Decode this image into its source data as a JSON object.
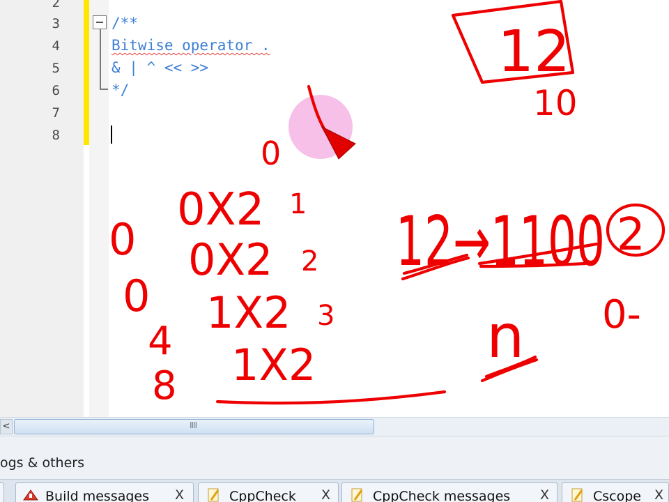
{
  "editor": {
    "line_numbers": [
      "2",
      "3",
      "4",
      "5",
      "6",
      "7",
      "8"
    ],
    "code_lines": [
      "/**",
      "Bitwise operator .",
      "& | ^ << >>",
      "*/"
    ]
  },
  "annotations": {
    "box_number": "12",
    "below_box": "10",
    "binary_expr": "12→1100",
    "circled": "2",
    "partial": "0-",
    "n_label": "n",
    "zero_top": "0",
    "left_digits": [
      "0",
      "0",
      "4",
      "8"
    ],
    "powers": [
      {
        "term": "0X2",
        "exp": "1"
      },
      {
        "term": "0X2",
        "exp": "2"
      },
      {
        "term": "1X2",
        "exp": "3"
      },
      {
        "term": "1X2",
        "exp": ""
      }
    ]
  },
  "scrollbar": {
    "left_arrow": "<",
    "grip": "IIII"
  },
  "logs": {
    "title": "ogs & others",
    "tabs": [
      {
        "label": "Build messages",
        "close": "X",
        "icon": "build-icon"
      },
      {
        "label": "CppCheck",
        "close": "X",
        "icon": "pencil-icon"
      },
      {
        "label": "CppCheck messages",
        "close": "X",
        "icon": "pencil-icon"
      },
      {
        "label": "Cscope",
        "close": "X",
        "icon": "pencil-icon"
      }
    ]
  },
  "colors": {
    "ink": "#ee0000",
    "code": "#3d7fd6",
    "change_bar": "#ffe600"
  }
}
